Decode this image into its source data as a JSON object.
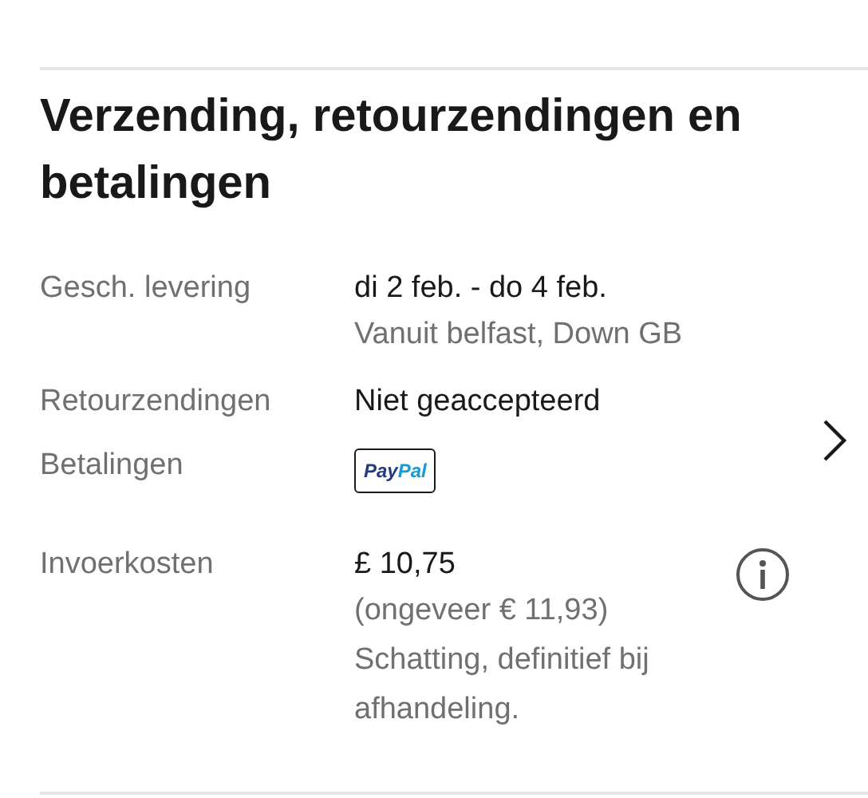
{
  "heading": "Verzending, retourzendingen en betalingen",
  "rows": [
    {
      "kind": "text",
      "label": "Gesch. levering",
      "lines": [
        {
          "text": "di 2 feb. - do 4 feb.",
          "muted": false
        },
        {
          "text": "Vanuit belfast, Down GB",
          "muted": true
        }
      ]
    },
    {
      "kind": "text",
      "label": "Retourzendingen",
      "lines": [
        {
          "text": "Niet geaccepteerd",
          "muted": false
        }
      ]
    },
    {
      "kind": "payment",
      "label": "Betalingen",
      "logo_parts": [
        "Pay",
        "Pal"
      ]
    },
    {
      "kind": "text",
      "label": "Invoerkosten",
      "info_icon": true,
      "lines": [
        {
          "text": "£ 10,75",
          "muted": false
        },
        {
          "text": "(ongeveer € 11,93)",
          "muted": true
        },
        {
          "text": "Schatting, definitief bij afhandeling.",
          "muted": true
        }
      ]
    }
  ]
}
